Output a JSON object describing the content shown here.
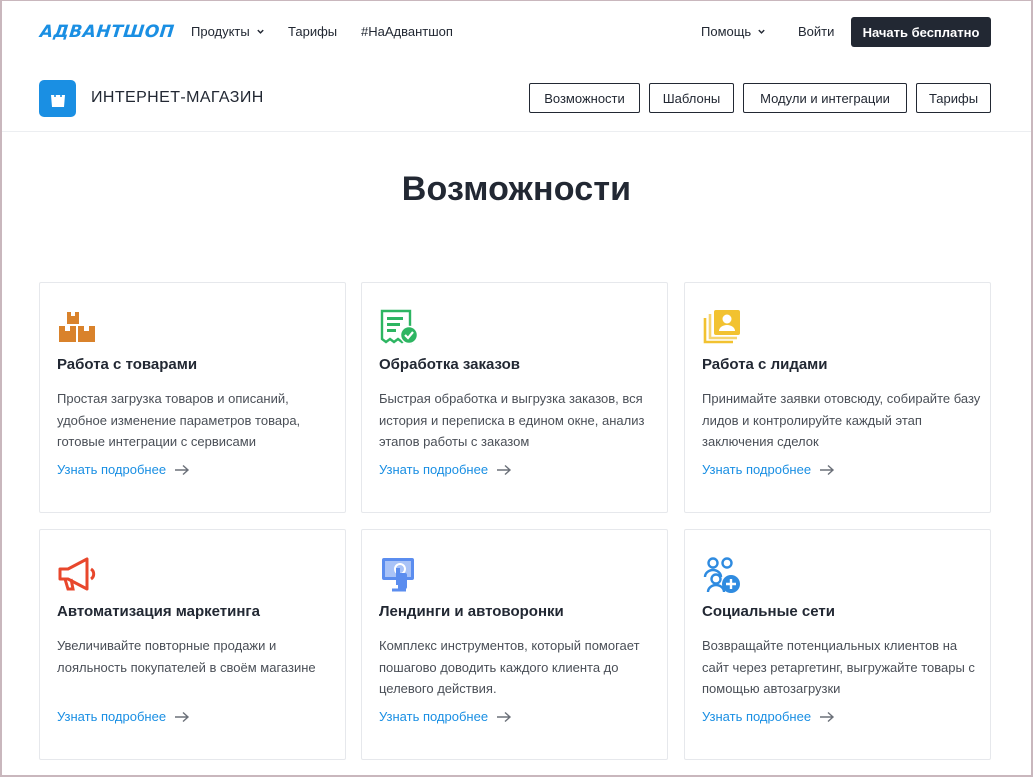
{
  "brand": {
    "logo_text": "АДВАНТШОП",
    "accent": "#1a8fe3",
    "dark": "#222833"
  },
  "topnav": {
    "products": "Продукты",
    "tariffs": "Тарифы",
    "hashtag": "#НаАдвантшоп",
    "help": "Помощь",
    "login": "Войти",
    "start_free": "Начать бесплатно"
  },
  "subheader": {
    "title": "ИНТЕРНЕТ-МАГАЗИН",
    "buttons": [
      "Возможности",
      "Шаблоны",
      "Модули и интеграции",
      "Тарифы"
    ]
  },
  "main": {
    "title": "Возможности",
    "cards": [
      {
        "title": "Работа с товарами",
        "text": "Простая загрузка товаров и описаний, удобное изменение параметров товара, готовые интеграции с сервисами",
        "link": "Узнать подробнее",
        "icon": "boxes-icon"
      },
      {
        "title": "Обработка заказов",
        "text": "Быстрая обработка и выгрузка заказов, вся история и переписка в едином окне, анализ этапов работы с заказом",
        "link": "Узнать подробнее",
        "icon": "receipt-check-icon"
      },
      {
        "title": "Работа с лидами",
        "text": "Принимайте заявки отовсюду, собирайте базу лидов и контролируйте каждый этап заключения сделок",
        "link": "Узнать подробнее",
        "icon": "contact-cards-icon"
      },
      {
        "title": "Автоматизация маркетинга",
        "text": "Увеличивайте повторные продажи и лояльность покупателей в своём магазине",
        "link": "Узнать подробнее",
        "icon": "megaphone-icon"
      },
      {
        "title": "Лендинги и автоворонки",
        "text": "Комплекс инструментов, который помогает пошагово доводить каждого клиента до целевого действия.",
        "link": "Узнать подробнее",
        "icon": "touch-screen-icon"
      },
      {
        "title": "Социальные сети",
        "text": "Возвращайте потенциальных клиентов на сайт через ретаргетинг, выгружайте товары с помощью автозагрузки",
        "link": "Узнать подробнее",
        "icon": "users-add-icon"
      }
    ]
  }
}
